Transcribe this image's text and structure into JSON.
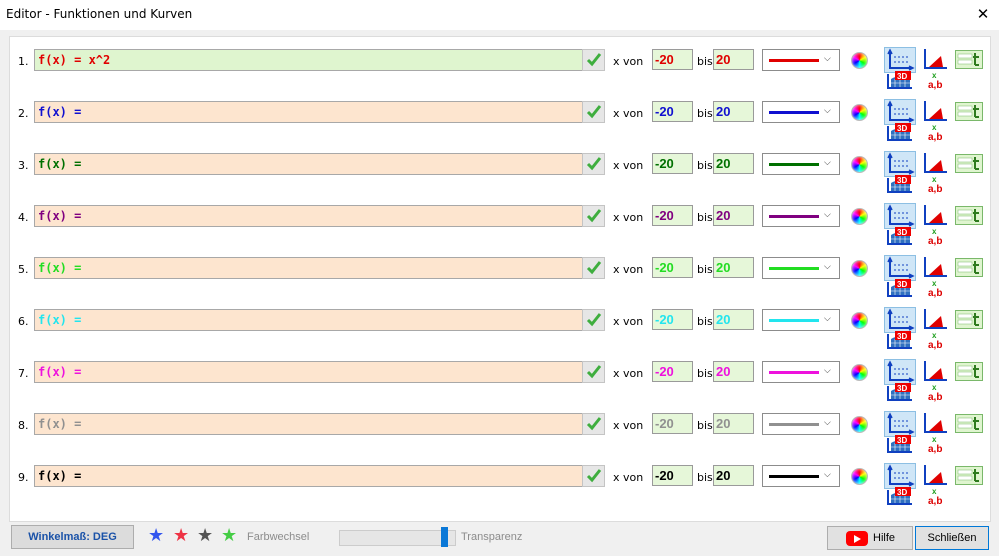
{
  "window": {
    "title": "Editor - Funktionen und Kurven",
    "close_glyph": "✕"
  },
  "labels": {
    "x_von": "x von",
    "bis": "bis"
  },
  "rows": [
    {
      "num": "1.",
      "expr": "f(x) = x^2",
      "from": "-20",
      "to": "20",
      "color": "#e00000",
      "bg": "#dff5cf"
    },
    {
      "num": "2.",
      "expr": "f(x) =",
      "from": "-20",
      "to": "20",
      "color": "#1010d0",
      "bg": "#fde5cf"
    },
    {
      "num": "3.",
      "expr": "f(x) =",
      "from": "-20",
      "to": "20",
      "color": "#007000",
      "bg": "#fde5cf"
    },
    {
      "num": "4.",
      "expr": "f(x) =",
      "from": "-20",
      "to": "20",
      "color": "#800080",
      "bg": "#fde5cf"
    },
    {
      "num": "5.",
      "expr": "f(x) =",
      "from": "-20",
      "to": "20",
      "color": "#22dd22",
      "bg": "#fde5cf"
    },
    {
      "num": "6.",
      "expr": "f(x) =",
      "from": "-20",
      "to": "20",
      "color": "#22e5ee",
      "bg": "#fde5cf"
    },
    {
      "num": "7.",
      "expr": "f(x) =",
      "from": "-20",
      "to": "20",
      "color": "#ee11dd",
      "bg": "#fde5cf"
    },
    {
      "num": "8.",
      "expr": "f(x) =",
      "from": "-20",
      "to": "20",
      "color": "#909090",
      "bg": "#fde5cf"
    },
    {
      "num": "9.",
      "expr": "f(x) =",
      "from": "-20",
      "to": "20",
      "color": "#000000",
      "bg": "#fde5cf"
    }
  ],
  "row_icons": [
    "checkmark-icon",
    "color-wheel-icon",
    "graph-axes-icon",
    "area-triangle-icon",
    "value-table-icon",
    "3d-icon",
    "parameter-ab-icon"
  ],
  "bottom": {
    "angle_button": "Winkelmaß: DEG",
    "stars": [
      {
        "name": "blue-star-icon",
        "color": "#3355ee"
      },
      {
        "name": "red-star-icon",
        "color": "#ee3344"
      },
      {
        "name": "dark-star-icon",
        "color": "#555555"
      },
      {
        "name": "green-star-icon",
        "color": "#44cc44"
      }
    ],
    "color_change_label": "Farbwechsel",
    "transparency_label": "Transparenz",
    "transparency_level": 0.93,
    "help_label": "Hilfe",
    "close_label": "Schließen"
  }
}
